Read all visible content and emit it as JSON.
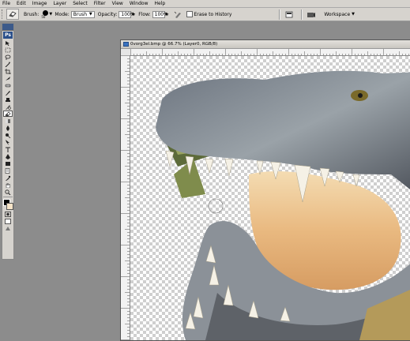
{
  "menu": [
    "File",
    "Edit",
    "Image",
    "Layer",
    "Select",
    "Filter",
    "View",
    "Window",
    "Help"
  ],
  "options": {
    "brush_label": "Brush:",
    "brush_size": "50",
    "mode_label": "Mode:",
    "mode_value": "Brush",
    "opacity_label": "Opacity:",
    "opacity_value": "100%",
    "flow_label": "Flow:",
    "flow_value": "100%",
    "erase_history_label": "Erase to History",
    "workspace_label": "Workspace"
  },
  "toolbox": {
    "logo": "Ps",
    "tools": [
      "move-tool-icon",
      "marquee-tool-icon",
      "lasso-tool-icon",
      "magic-wand-tool-icon",
      "crop-tool-icon",
      "slice-tool-icon",
      "healing-brush-tool-icon",
      "brush-tool-icon",
      "clone-stamp-tool-icon",
      "history-brush-tool-icon",
      "eraser-tool-icon",
      "gradient-tool-icon",
      "blur-tool-icon",
      "dodge-tool-icon",
      "path-selection-tool-icon",
      "type-tool-icon",
      "pen-tool-icon",
      "shape-tool-icon",
      "notes-tool-icon",
      "eyedropper-tool-icon",
      "hand-tool-icon",
      "zoom-tool-icon"
    ],
    "active_tool": "eraser-tool-icon",
    "foreground_color": "#000000",
    "background_color": "#f7e4c8"
  },
  "document": {
    "title": "0vorg3el.bmp @ 66.7% (Layer0, RGB/8)"
  },
  "colors": {
    "ui_gray": "#d6d3ce",
    "workspace_gray": "#8c8c8c",
    "title_icon_blue": "#3a73c0"
  }
}
